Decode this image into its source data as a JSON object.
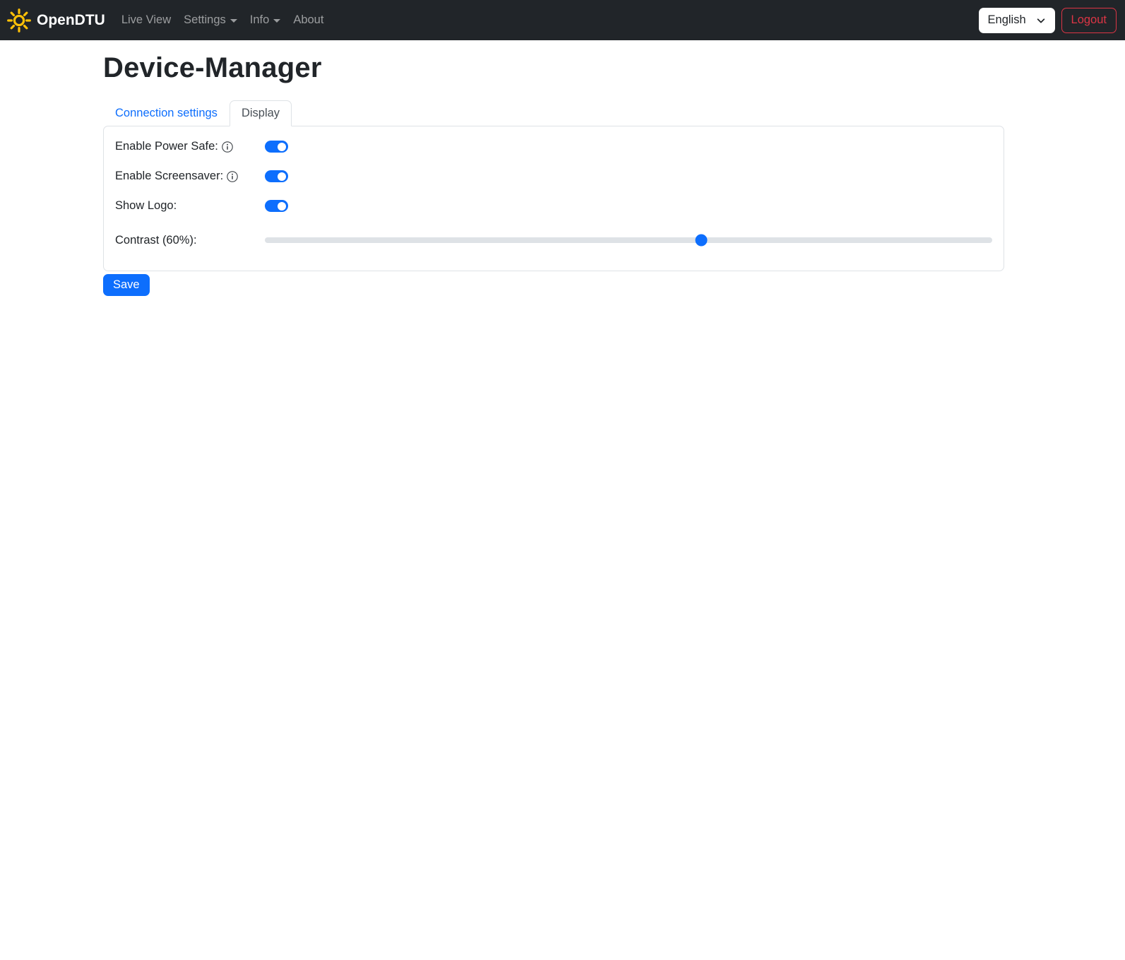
{
  "navbar": {
    "brand": "OpenDTU",
    "items": [
      {
        "label": "Live View",
        "dropdown": false
      },
      {
        "label": "Settings",
        "dropdown": true
      },
      {
        "label": "Info",
        "dropdown": true
      },
      {
        "label": "About",
        "dropdown": false
      }
    ],
    "language_selected": "English",
    "logout_label": "Logout"
  },
  "page": {
    "title": "Device-Manager",
    "tabs": [
      {
        "label": "Connection settings",
        "active": false
      },
      {
        "label": "Display",
        "active": true
      }
    ]
  },
  "form": {
    "rows": [
      {
        "label": "Enable Power Safe:",
        "type": "switch",
        "value": true,
        "info": true
      },
      {
        "label": "Enable Screensaver:",
        "type": "switch",
        "value": true,
        "info": true
      },
      {
        "label": "Show Logo:",
        "type": "switch",
        "value": true,
        "info": false
      },
      {
        "label": "Contrast (60%):",
        "type": "range",
        "value": 60,
        "min": 0,
        "max": 100
      }
    ],
    "save_label": "Save"
  },
  "colors": {
    "primary": "#0d6efd",
    "navbar_bg": "#212529",
    "danger": "#dc3545",
    "brand_icon": "#ffc107",
    "border": "#dee2e6"
  }
}
